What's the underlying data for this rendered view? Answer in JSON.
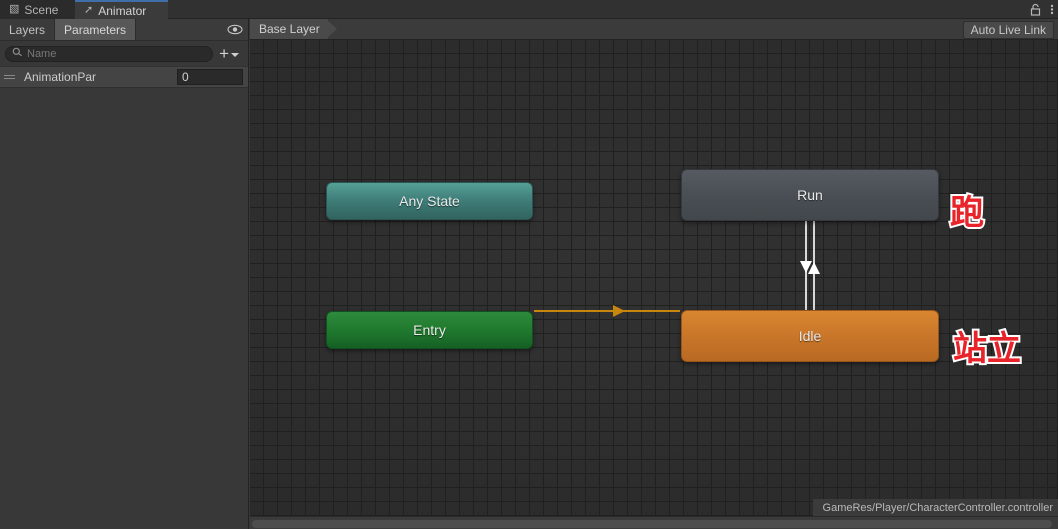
{
  "window": {
    "tabs": [
      {
        "label": "Scene",
        "icon": "grid-icon",
        "active": false
      },
      {
        "label": "Animator",
        "icon": "animator-icon",
        "active": true
      }
    ],
    "lock_icon": "lock-icon",
    "menu_icon": "kebab-menu-icon"
  },
  "left_panel": {
    "subtabs": [
      {
        "label": "Layers",
        "active": false
      },
      {
        "label": "Parameters",
        "active": true
      }
    ],
    "visibility_icon": "eye-icon",
    "search": {
      "icon": "search-icon",
      "value": "",
      "placeholder": "Name"
    },
    "add_button": {
      "label": "+",
      "dropdown_icon": "chevron-down-icon"
    },
    "parameters": [
      {
        "name": "AnimationPar",
        "value": "0",
        "handle_icon": "drag-handle-icon"
      }
    ]
  },
  "graph": {
    "breadcrumb": "Base Layer",
    "auto_live_link_label": "Auto Live Link",
    "nodes": [
      {
        "id": "any-state",
        "label": "Any State",
        "kind": "any-state"
      },
      {
        "id": "entry",
        "label": "Entry",
        "kind": "entry"
      },
      {
        "id": "run",
        "label": "Run",
        "kind": "normal"
      },
      {
        "id": "idle",
        "label": "Idle",
        "kind": "default"
      }
    ],
    "annotations": [
      {
        "text": "跑",
        "for": "run"
      },
      {
        "text": "站立",
        "for": "idle"
      }
    ],
    "transitions": [
      {
        "from": "entry",
        "to": "idle",
        "color": "#c8860f",
        "bidirectional": false
      },
      {
        "from": "run",
        "to": "idle",
        "color": "#d8d8d8",
        "bidirectional": true
      }
    ],
    "status_path": "GameRes/Player/CharacterController.controller"
  },
  "colors": {
    "accent_tab": "#3e6fa8",
    "any_state": "#3e7c77",
    "entry": "#207a2e",
    "run": "#4a4f55",
    "idle": "#c9762a",
    "entry_link": "#c8860f",
    "annotation_red": "#e8232a"
  }
}
